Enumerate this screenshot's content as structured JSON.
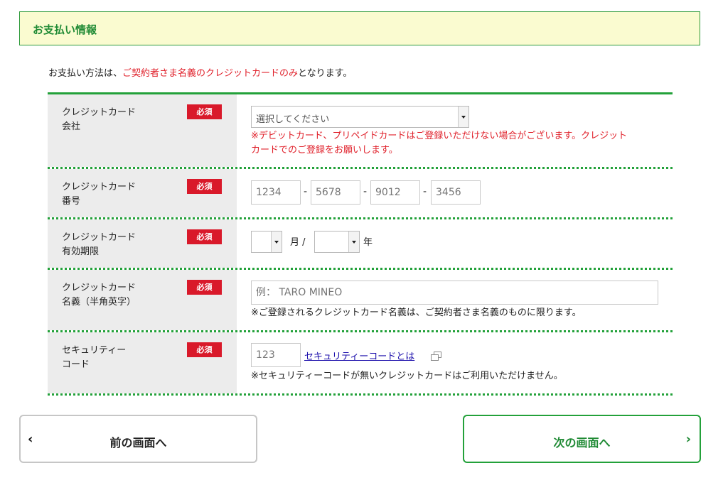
{
  "section": {
    "title": "お支払い情報"
  },
  "intro": {
    "prefix": "お支払い方法は、",
    "highlight": "ご契約者さま名義のクレジットカードのみ",
    "suffix": "となります。"
  },
  "required_label": "必須",
  "fields": {
    "company": {
      "label_line1": "クレジットカード",
      "label_line2": "会社",
      "select_value": "選択してください",
      "note_line1": "※デビットカード、プリペイドカードはご登録いただけない場合がございます。クレジット",
      "note_line2": "カードでのご登録をお願いします。"
    },
    "number": {
      "label_line1": "クレジットカード",
      "label_line2": "番号",
      "placeholders": [
        "1234",
        "5678",
        "9012",
        "3456"
      ],
      "separator": "-"
    },
    "expiry": {
      "label_line1": "クレジットカード",
      "label_line2": "有効期限",
      "month_value": "",
      "year_value": "",
      "month_unit": "月 /",
      "year_unit": "年"
    },
    "holder": {
      "label_line1": "クレジットカード",
      "label_line2": "名義（半角英字）",
      "placeholder": "例： TARO MINEO",
      "note": "※ご登録されるクレジットカード名義は、ご契約者さま名義のものに限ります。"
    },
    "security": {
      "label_line1": "セキュリティー",
      "label_line2": "コード",
      "placeholder": "123",
      "link": "セキュリティーコードとは",
      "note": "※セキュリティーコードが無いクレジットカードはご利用いただけません。"
    }
  },
  "buttons": {
    "prev": {
      "label": "前の画面へ",
      "icon": "chevron-left-icon"
    },
    "next": {
      "label": "次の画面へ",
      "icon": "chevron-right-icon"
    }
  },
  "colors": {
    "accent_green": "#23a13a",
    "required_red": "#d9192a",
    "warning_red": "#e0212b",
    "header_bg": "#fafbd0",
    "label_bg": "#ececec",
    "link_blue": "#1a0dab"
  }
}
